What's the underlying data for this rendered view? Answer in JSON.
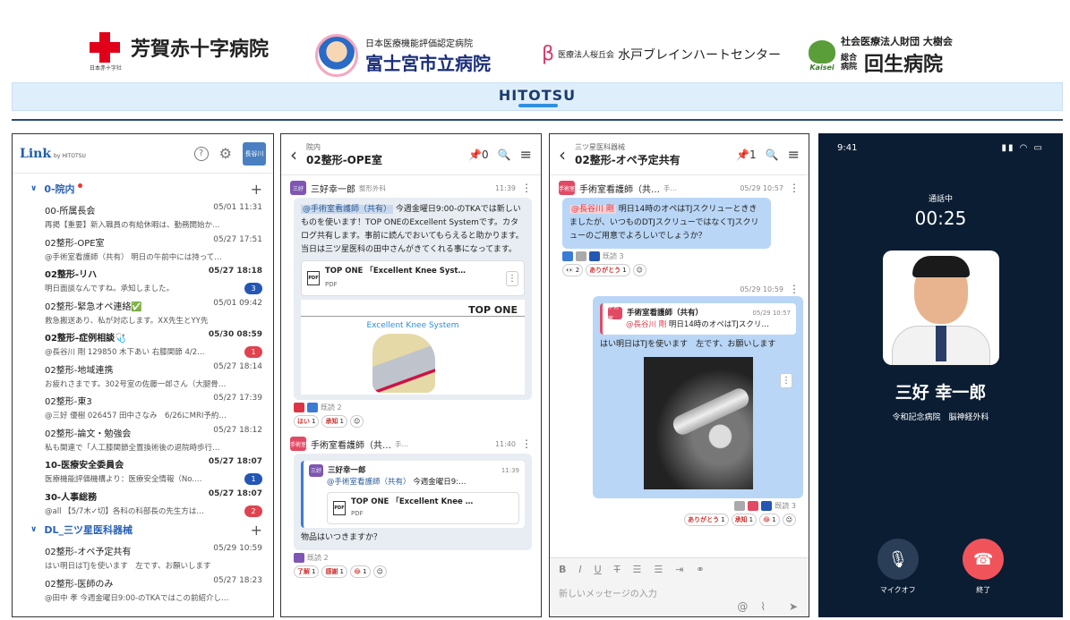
{
  "logos": {
    "l1": "芳賀赤十字病院",
    "l1cap": "日本赤十字社",
    "l2sub": "日本医療機能評価認定病院",
    "l2": "富士宮市立病院",
    "l3pre": "医療法人桜丘会",
    "l3": "水戸ブレインハートセンター",
    "l4sub": "社会医療法人財団 大樹会",
    "l4small": "総合\n病院",
    "l4": "回生病院",
    "l4mark": "Kaisei"
  },
  "banner": "HITOTSU",
  "p1": {
    "brand": "Link",
    "brand_by": "by HITOTSU",
    "avatar": "長谷川",
    "sections": [
      {
        "name": "0-院内",
        "channels": [
          {
            "name": "00-所属長会",
            "time": "05/01 11:31",
            "preview": "再掲【重要】新入職員の有給休暇は、勤務開始か…",
            "bold": false
          },
          {
            "name": "02整形-OPE室",
            "time": "05/27 17:51",
            "preview": "@手術室看護師（共有） 明日の午前中には持って…",
            "bold": false
          },
          {
            "name": "02整形-リハ",
            "time": "05/27 18:18",
            "preview": "明日面談なんですね。承知しました。",
            "bold": true,
            "badge": "3",
            "bc": "#2456b4"
          },
          {
            "name": "02整形-緊急オペ連絡✅",
            "time": "05/01 09:42",
            "preview": "救急搬送あり、私が対応します。XX先生とYY先",
            "bold": false
          },
          {
            "name": "02整形-症例相談🩺",
            "time": "05/30 08:59",
            "preview": "@長谷川 剛 129850 木下あい 右膝関節 4/2…",
            "bold": true,
            "badge": "1",
            "bc": "#e0434f"
          },
          {
            "name": "02整形-地域連携",
            "time": "05/27 18:14",
            "preview": "お疲れさまです。302号室の佐藤一郎さん（大腿骨…",
            "bold": false
          },
          {
            "name": "02整形-東3",
            "time": "05/27 17:39",
            "preview": "@三好 優樹 026457 田中さなみ　6/26にMRI予約…",
            "bold": false
          },
          {
            "name": "02整形-論文・勉強会",
            "time": "05/27 18:12",
            "preview": "私も関連で「人工膝関節全置換術後の退院時歩行…",
            "bold": false
          },
          {
            "name": "10-医療安全委員会",
            "time": "05/27 18:07",
            "preview": "医療機能評価機構より：医療安全情報（No.…",
            "bold": true,
            "badge": "1",
            "bc": "#2456b4"
          },
          {
            "name": "30-人事総務",
            "time": "05/27 18:07",
            "preview": "@all 【5/7木✓切】各科の科部長の先生方は…",
            "bold": true,
            "badge": "2",
            "bc": "#e0434f"
          }
        ]
      },
      {
        "name": "DL_三ツ星医科器械",
        "channels": [
          {
            "name": "02整形-オペ予定共有",
            "time": "05/29 10:59",
            "preview": "はい明日はTJを使います　左です、お願いします",
            "bold": false
          },
          {
            "name": "02整形-医師のみ",
            "time": "05/27 18:23",
            "preview": "@田中 孝 今週金曜日9:00-のTKAではこの前紹介し…",
            "bold": false
          }
        ]
      }
    ]
  },
  "p2": {
    "sub": "院内",
    "title": "02整形-OPE室",
    "pins": "0",
    "m1": {
      "av": "三好",
      "name": "三好幸一郎",
      "dept": "整形外科",
      "time": "11:39",
      "mention": "@手術室看護師（共有）",
      "text": "今週金曜日9:00-のTKAでは新しいものを使います！TOP ONEのExcellent Systemです。カタログ共有します。事前に読んでおいてもらえると助かります。当日は三ツ星医科の田中さんがきてくれる事になってます。",
      "file": "TOP ONE 「Excellent Knee Syst…",
      "ftype": "PDF",
      "brand": "TOP ONE",
      "sys": "Excellent  Knee  System",
      "read": "既読 2"
    },
    "r1": [
      {
        "e": "はい",
        "n": "1"
      },
      {
        "e": "承知",
        "n": "1"
      }
    ],
    "m2": {
      "av": "手術室",
      "name": "手術室看護師（共…",
      "dept": "手…",
      "time": "11:40",
      "q_name": "三好幸一郎",
      "q_time": "11:39",
      "q_mention": "@手術室看護師（共有）",
      "q_text": "今週金曜日9:…",
      "file": "TOP ONE 「Excellent Knee …",
      "ftype": "PDF",
      "text": "物品はいつきますか？",
      "read": "既読 2"
    },
    "r2": [
      {
        "e": "了解",
        "n": "1"
      },
      {
        "e": "感謝",
        "n": "1"
      },
      {
        "e": "😂",
        "n": "1"
      }
    ]
  },
  "p3": {
    "sub": "三ツ星医科器械",
    "title": "02整形-オペ予定共有",
    "pins": "1",
    "m1": {
      "av": "手術室",
      "name": "手術室看護師（共…",
      "dept": "手…",
      "time": "05/29 10:57",
      "mention": "@長谷川 剛",
      "text": "明日14時のオペはTJスクリューとききましたが、いつものDTJスクリューではなくTJスクリューのご用意でよろしいでしょうか？",
      "read": "既読 3"
    },
    "r1": [
      {
        "e": "👀",
        "n": "2"
      },
      {
        "e": "ありがとう",
        "n": "1"
      }
    ],
    "m2": {
      "time": "05/29 10:59",
      "q_name": "手術室看護師（共有）",
      "q_time": "05/29 10:57",
      "q_mention": "@長谷川 剛",
      "q_text": "明日14時のオペはTJスクリ…",
      "text": "はい明日はTJを使います　左です、お願いします",
      "read": "既読 3"
    },
    "r2": [
      {
        "e": "ありがとう",
        "n": "1"
      },
      {
        "e": "承知",
        "n": "1"
      },
      {
        "e": "😂",
        "n": "1"
      }
    ],
    "placeholder": "新しいメッセージの入力"
  },
  "p4": {
    "clock": "9:41",
    "status": "通話中",
    "timer": "00:25",
    "name": "三好 幸一郎",
    "org": "令和記念病院　脳神経外科",
    "mute": "マイクオフ",
    "end": "終了"
  }
}
